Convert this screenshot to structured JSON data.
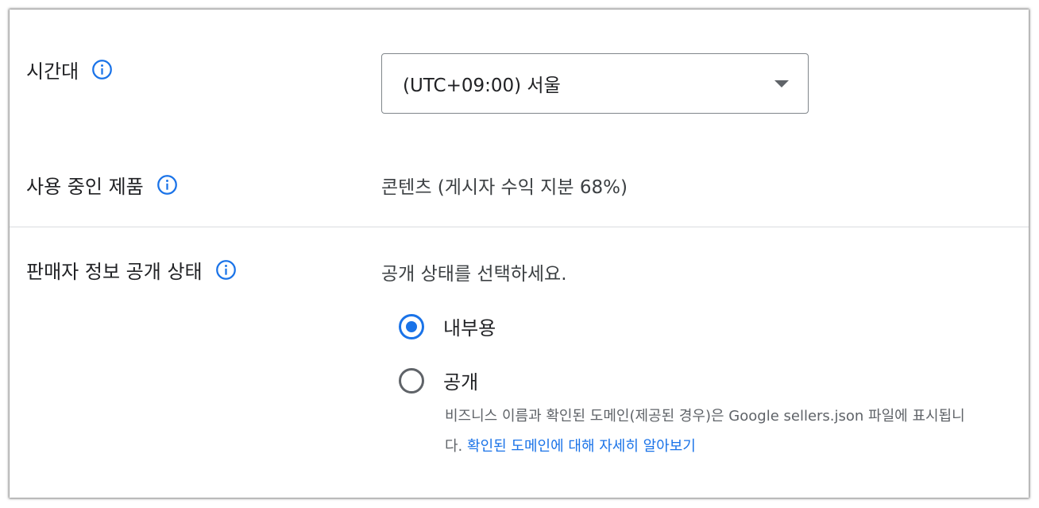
{
  "timezone": {
    "label": "시간대",
    "value": "(UTC+09:00) 서울"
  },
  "product": {
    "label": "사용 중인 제품",
    "value": "콘텐츠 (게시자 수익 지분 68%)"
  },
  "seller_visibility": {
    "label": "판매자 정보 공개 상태",
    "prompt": "공개 상태를 선택하세요.",
    "options": [
      {
        "label": "내부용",
        "selected": true
      },
      {
        "label": "공개",
        "selected": false
      }
    ],
    "help_text": "비즈니스 이름과 확인된 도메인(제공된 경우)은 Google sellers.json 파일에 표시됩니다. ",
    "help_link": "확인된 도메인에 대해 자세히 알아보기"
  },
  "colors": {
    "accent": "#1a73e8",
    "text": "#202124",
    "secondary_text": "#5f6368",
    "divider": "#dadce0"
  }
}
